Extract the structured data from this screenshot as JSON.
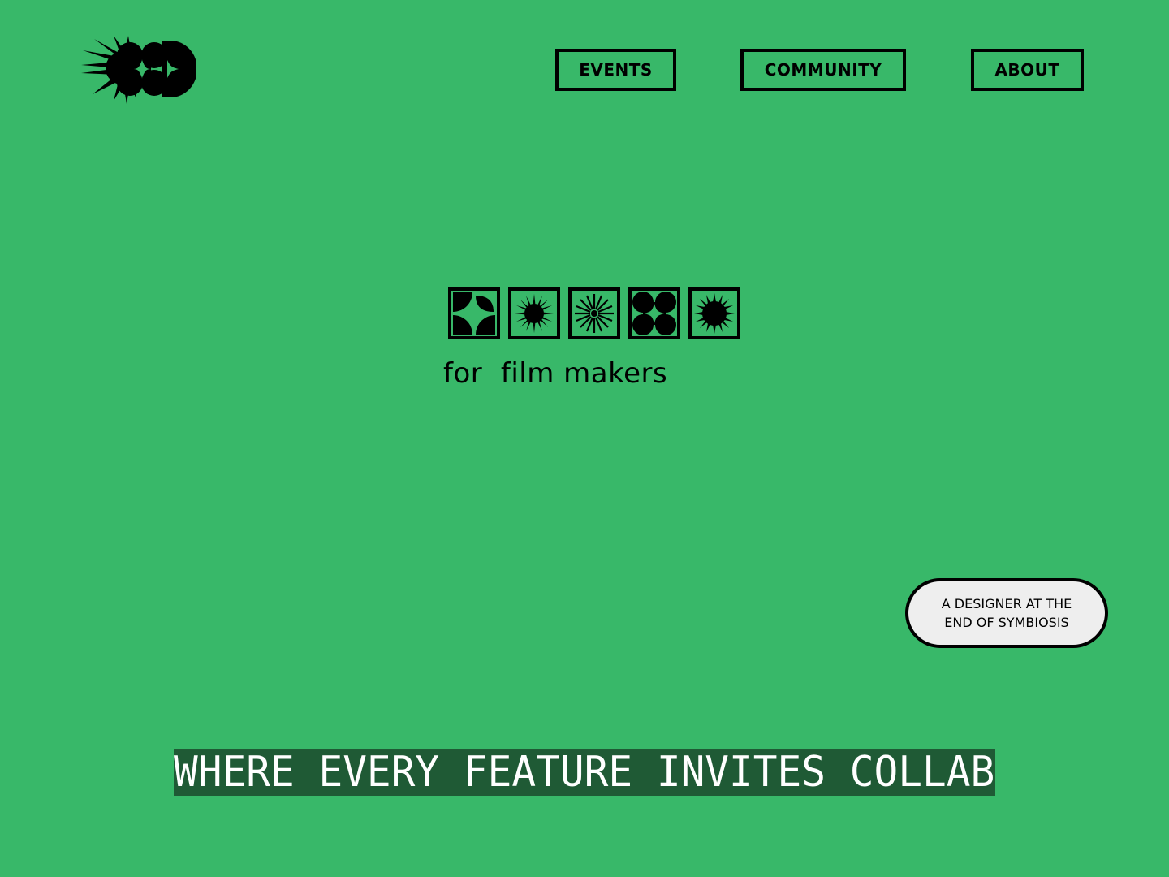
{
  "colors": {
    "background": "#38b869",
    "ink": "#000000",
    "marquee_bg": "#1f5a35",
    "marquee_text": "#ffffff",
    "pill_bg": "#eeeeee"
  },
  "header": {
    "logo_icon": "burst-circle-logo-icon",
    "nav": [
      {
        "label": "EVENTS"
      },
      {
        "label": "COMMUNITY"
      },
      {
        "label": "ABOUT"
      }
    ]
  },
  "hero": {
    "tile_icons": [
      "petal-quad-icon",
      "burst-icon",
      "radial-lines-icon",
      "four-circle-star-icon",
      "sun-burst-icon"
    ],
    "tagline": "for  film makers"
  },
  "pill": {
    "line1": "A DESIGNER AT THE",
    "line2": "END OF SYMBIOSIS"
  },
  "marquee": {
    "text": "WHERE EVERY FEATURE INVITES COLLABORATION,"
  }
}
